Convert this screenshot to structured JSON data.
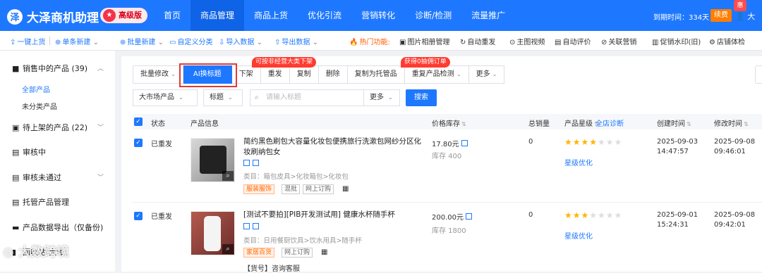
{
  "topbar": {
    "logo": "大泽商机助理",
    "logo_mark": "泽",
    "premium_label": "高级版",
    "nav": [
      "首页",
      "商品管理",
      "商品上货",
      "优化引流",
      "营销转化",
      "诊断/检测",
      "流量推广"
    ],
    "expire": "到期时间：334天",
    "renew": "续费",
    "gift_badge": "惠",
    "user": "大"
  },
  "toolbar": {
    "items": [
      "一键上货",
      "单条新建",
      "批量新建",
      "自定义分类",
      "导入数据",
      "导出数据"
    ],
    "hot_label": "热门功能:",
    "hot_items": [
      "图片相册管理",
      "自动重发",
      "主图视频",
      "自动评价",
      "关联营销",
      "促销水印(旧)",
      "店铺体检"
    ]
  },
  "sidebar": {
    "items": [
      "销售中的产品 (39)",
      "待上架的产品 (22)",
      "审核中",
      "审核未通过",
      "托管产品管理",
      "产品数据导出（仅备份)",
      "回收站(大泽)"
    ],
    "subitems": [
      "全部产品",
      "未分类产品"
    ]
  },
  "actions": {
    "buttons": [
      "批量修改",
      "AI换标题",
      "下架",
      "重发",
      "复制",
      "删除",
      "复制为托管品",
      "重复产品检测",
      "更多"
    ],
    "tip1": "可按非经营大类下架",
    "tip2": "获得0抽佣订单"
  },
  "filters": {
    "market": "大市场产品",
    "field": "标题",
    "search_placeholder": "请输入标题",
    "more": "更多",
    "search_btn": "搜索"
  },
  "table": {
    "headers": [
      "状态",
      "产品信息",
      "价格库存",
      "总销量",
      "产品星级",
      "全店诊断",
      "创建时间",
      "修改时间"
    ],
    "rows": [
      {
        "status": "已重发",
        "title": "简约黑色刷包大容量化妆包便携旅行洗漱包网纱分区化妆刷纳包女",
        "category": "类目：箱包皮具>化妆箱包>化妆包",
        "tags": [
          "服装服饰",
          "混批",
          "网上订购"
        ],
        "price": "17.80元",
        "stock": "库存 400",
        "sales": "0",
        "stars": 4,
        "optimize": "星级优化",
        "created_date": "2025-09-03",
        "created_time": "14:47:57",
        "modified_date": "2025-09-08",
        "modified_time": "09:46:01"
      },
      {
        "status": "已重发",
        "title": "[测试不要拍][PIB开发测试用] 健康水杯随手杯",
        "category": "类目：日用餐厨饮具>饮水用具>随手杯",
        "tags": [
          "家居百货",
          "网上订购"
        ],
        "price": "200.00元",
        "stock": "库存 1800",
        "sales": "0",
        "stars": 3,
        "optimize": "星级优化",
        "created_date": "2025-09-01",
        "created_time": "15:24:31",
        "modified_date": "2025-09-08",
        "modified_time": "09:42:01",
        "extra": "【货号】咨询客服"
      }
    ]
  },
  "watermark": "大数跨境"
}
